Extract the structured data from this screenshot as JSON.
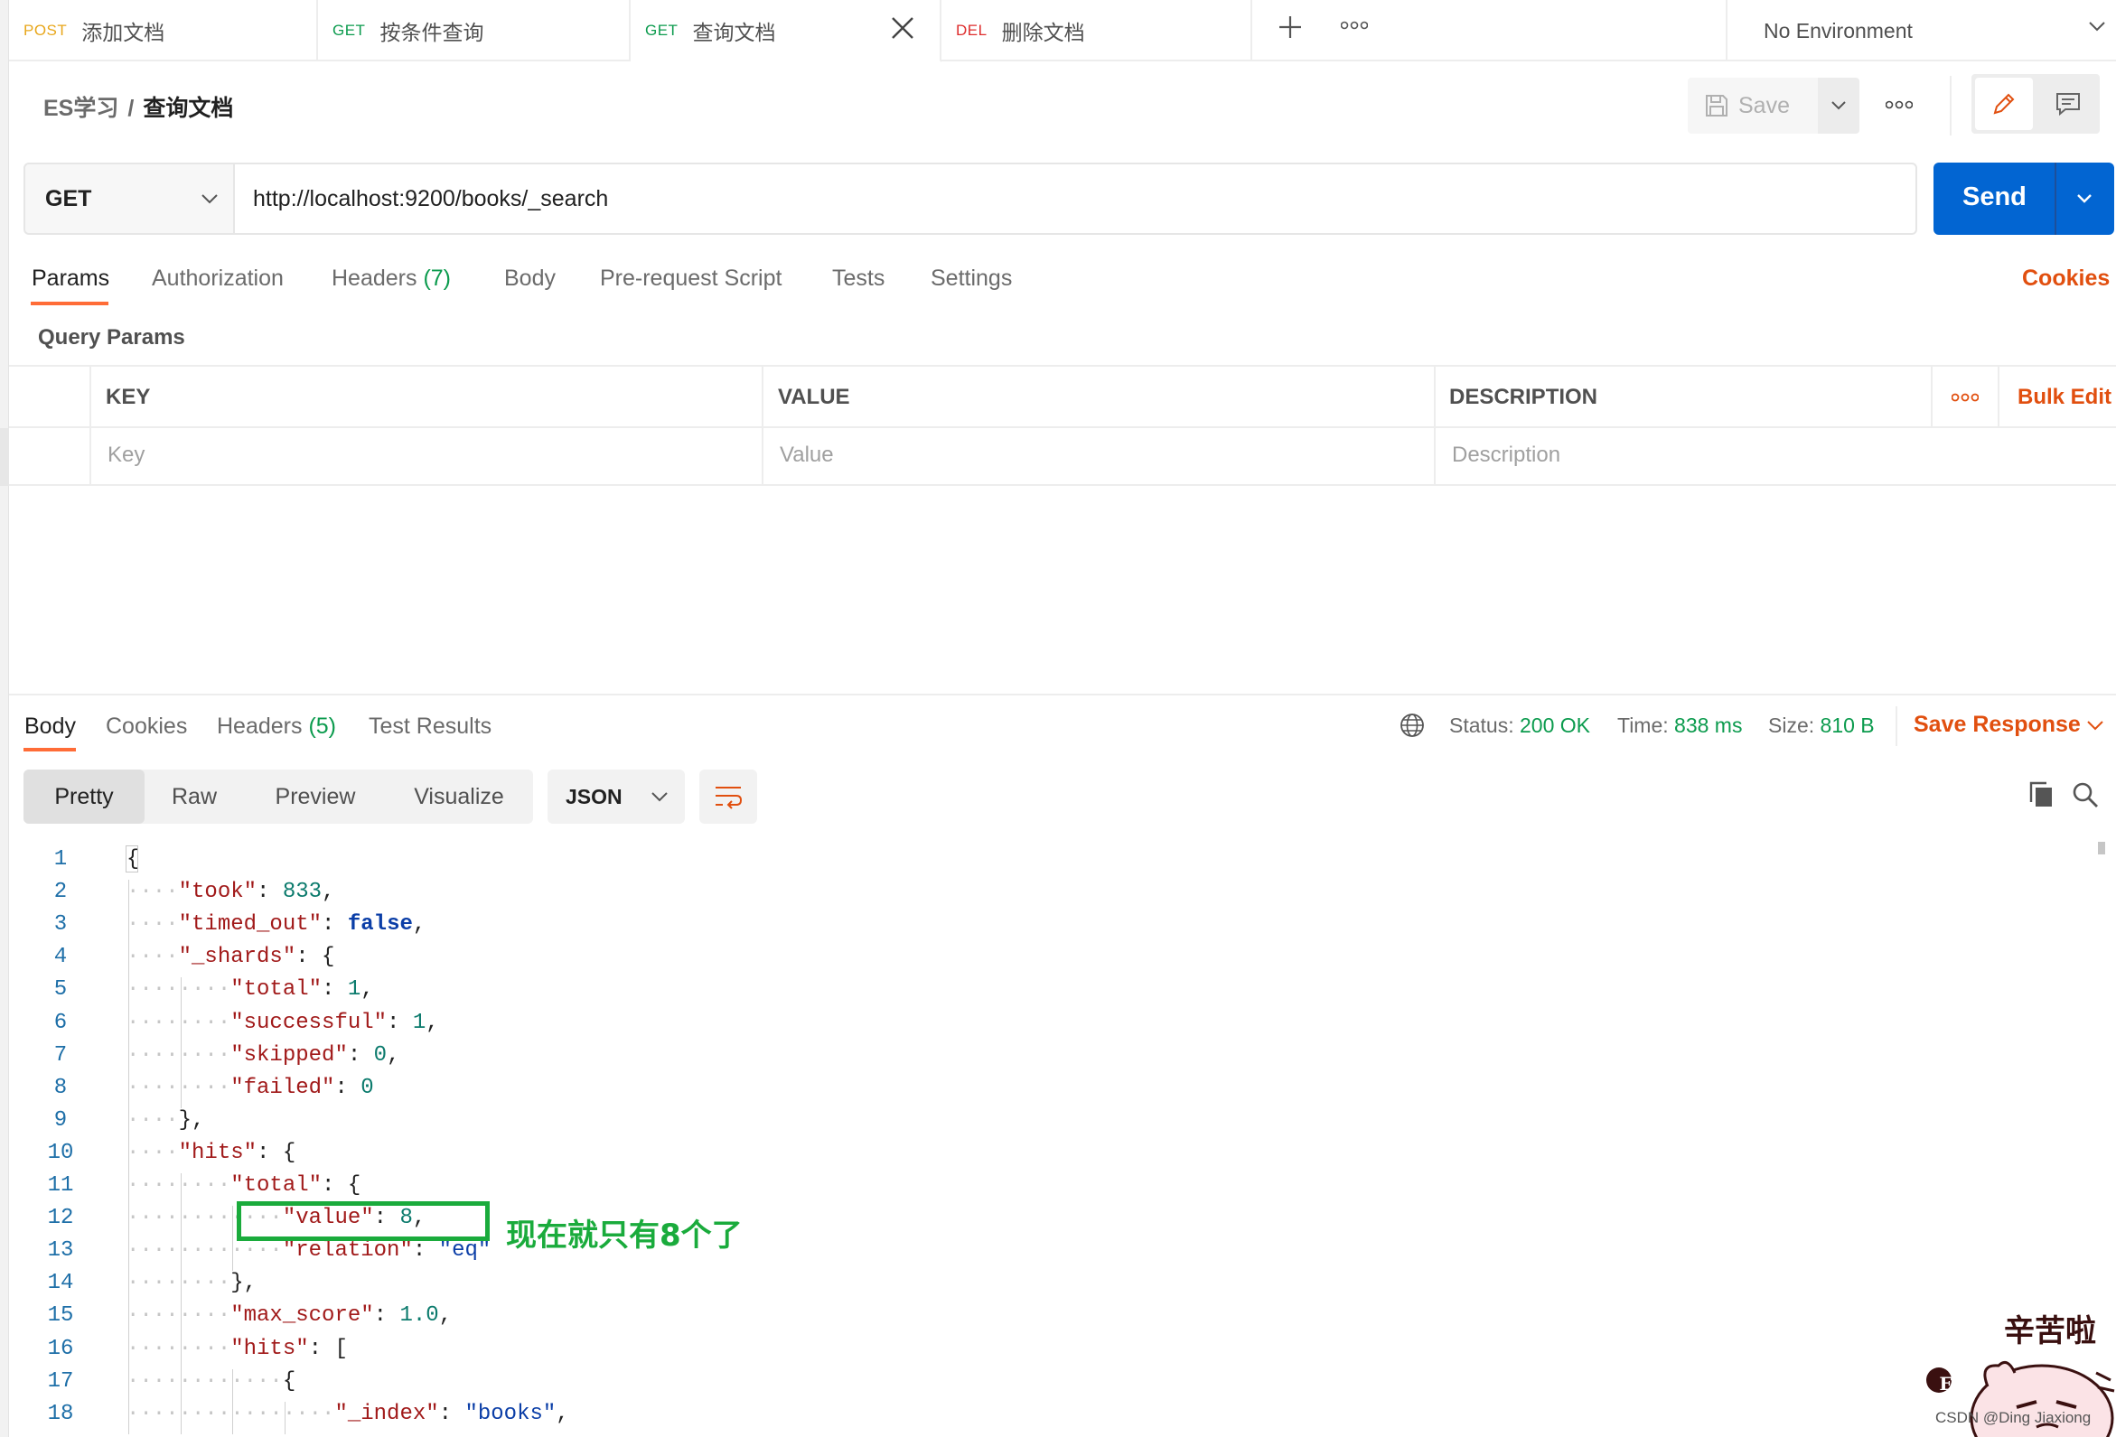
{
  "tabs": [
    {
      "method": "POST",
      "label": "添加文档"
    },
    {
      "method": "GET",
      "label": "按条件查询"
    },
    {
      "method": "GET",
      "label": "查询文档"
    },
    {
      "method": "DEL",
      "label": "删除文档"
    }
  ],
  "environment": "No Environment",
  "breadcrumb": {
    "collection": "ES学习",
    "separator": "/",
    "request": "查询文档"
  },
  "header": {
    "save_label": "Save"
  },
  "request": {
    "method": "GET",
    "url": "http://localhost:9200/books/_search",
    "send_label": "Send"
  },
  "request_tabs": {
    "params": "Params",
    "authorization": "Authorization",
    "headers": "Headers",
    "headers_count": "(7)",
    "body": "Body",
    "prerequest": "Pre-request Script",
    "tests": "Tests",
    "settings": "Settings",
    "cookies": "Cookies"
  },
  "query_params": {
    "title": "Query Params",
    "headers": {
      "key": "KEY",
      "value": "VALUE",
      "description": "DESCRIPTION"
    },
    "placeholders": {
      "key": "Key",
      "value": "Value",
      "description": "Description"
    },
    "bulk_edit": "Bulk Edit"
  },
  "response_tabs": {
    "body": "Body",
    "cookies": "Cookies",
    "headers": "Headers",
    "headers_count": "(5)",
    "test_results": "Test Results"
  },
  "response_meta": {
    "status_label": "Status:",
    "status": "200 OK",
    "time_label": "Time:",
    "time": "838 ms",
    "size_label": "Size:",
    "size": "810 B",
    "save_response": "Save Response"
  },
  "format": {
    "pretty": "Pretty",
    "raw": "Raw",
    "preview": "Preview",
    "visualize": "Visualize",
    "language": "JSON"
  },
  "code_lines": [
    {
      "num": "1",
      "indent": 0,
      "parts": [
        [
          "p",
          "{"
        ]
      ]
    },
    {
      "num": "2",
      "indent": 1,
      "parts": [
        [
          "k",
          "\"took\""
        ],
        [
          "p",
          ": "
        ],
        [
          "n",
          "833"
        ],
        [
          "p",
          ","
        ]
      ]
    },
    {
      "num": "3",
      "indent": 1,
      "parts": [
        [
          "k",
          "\"timed_out\""
        ],
        [
          "p",
          ": "
        ],
        [
          "b",
          "false"
        ],
        [
          "p",
          ","
        ]
      ]
    },
    {
      "num": "4",
      "indent": 1,
      "parts": [
        [
          "k",
          "\"_shards\""
        ],
        [
          "p",
          ": {"
        ]
      ]
    },
    {
      "num": "5",
      "indent": 2,
      "parts": [
        [
          "k",
          "\"total\""
        ],
        [
          "p",
          ": "
        ],
        [
          "n",
          "1"
        ],
        [
          "p",
          ","
        ]
      ]
    },
    {
      "num": "6",
      "indent": 2,
      "parts": [
        [
          "k",
          "\"successful\""
        ],
        [
          "p",
          ": "
        ],
        [
          "n",
          "1"
        ],
        [
          "p",
          ","
        ]
      ]
    },
    {
      "num": "7",
      "indent": 2,
      "parts": [
        [
          "k",
          "\"skipped\""
        ],
        [
          "p",
          ": "
        ],
        [
          "n",
          "0"
        ],
        [
          "p",
          ","
        ]
      ]
    },
    {
      "num": "8",
      "indent": 2,
      "parts": [
        [
          "k",
          "\"failed\""
        ],
        [
          "p",
          ": "
        ],
        [
          "n",
          "0"
        ]
      ]
    },
    {
      "num": "9",
      "indent": 1,
      "parts": [
        [
          "p",
          "},"
        ]
      ]
    },
    {
      "num": "10",
      "indent": 1,
      "parts": [
        [
          "k",
          "\"hits\""
        ],
        [
          "p",
          ": {"
        ]
      ]
    },
    {
      "num": "11",
      "indent": 2,
      "parts": [
        [
          "k",
          "\"total\""
        ],
        [
          "p",
          ": {"
        ]
      ]
    },
    {
      "num": "12",
      "indent": 3,
      "parts": [
        [
          "k",
          "\"value\""
        ],
        [
          "p",
          ": "
        ],
        [
          "n",
          "8"
        ],
        [
          "p",
          ","
        ]
      ]
    },
    {
      "num": "13",
      "indent": 3,
      "parts": [
        [
          "k",
          "\"relation\""
        ],
        [
          "p",
          ": "
        ],
        [
          "s",
          "\"eq\""
        ]
      ]
    },
    {
      "num": "14",
      "indent": 2,
      "parts": [
        [
          "p",
          "},"
        ]
      ]
    },
    {
      "num": "15",
      "indent": 2,
      "parts": [
        [
          "k",
          "\"max_score\""
        ],
        [
          "p",
          ": "
        ],
        [
          "n",
          "1.0"
        ],
        [
          "p",
          ","
        ]
      ]
    },
    {
      "num": "16",
      "indent": 2,
      "parts": [
        [
          "k",
          "\"hits\""
        ],
        [
          "p",
          ": ["
        ]
      ]
    },
    {
      "num": "17",
      "indent": 3,
      "parts": [
        [
          "p",
          "{"
        ]
      ]
    },
    {
      "num": "18",
      "indent": 4,
      "parts": [
        [
          "k",
          "\"_index\""
        ],
        [
          "p",
          ": "
        ],
        [
          "s",
          "\"books\""
        ],
        [
          "p",
          ","
        ]
      ]
    }
  ],
  "annotation": "现在就只有8个了",
  "sticker": {
    "text": "辛苦啦",
    "badge": "E",
    "watermark": "CSDN @Ding Jiaxiong"
  },
  "colors": {
    "accent": "#ff6c37",
    "send": "#0265d2",
    "success": "#0c9b4e",
    "annotation": "#1aab3c"
  }
}
